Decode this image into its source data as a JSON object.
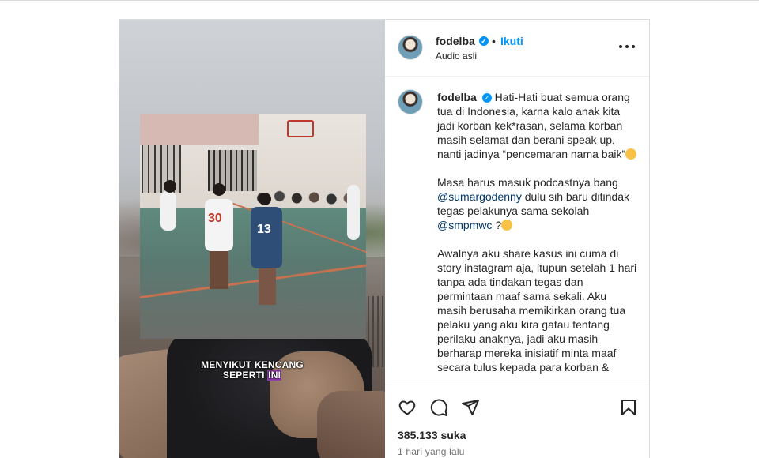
{
  "post": {
    "username": "fodelba",
    "follow_label": "Ikuti",
    "header_dot": "•",
    "audio_label": "Audio asli",
    "caption_overlay": {
      "line1": "MENYIKUT KENCANG",
      "line2_pre": "SEPERTI ",
      "line2_highlight": "INI"
    },
    "jersey_numbers": [
      "30",
      "13"
    ],
    "comment": {
      "username": "fodelba",
      "para1": "Hati-Hati buat semua orang tua di Indonesia, karna kalo anak kita jadi korban kek*rasan, selama korban masih selamat dan berani speak up, nanti jadinya “pencemaran nama baik”",
      "para2_a": "Masa harus masuk podcastnya bang",
      "mention1": "@sumargodenny",
      "para2_b": "dulu sih baru ditindak tegas pelakunya sama sekolah",
      "mention2": "@smpmwc",
      "para2_c": "?",
      "para3": "Awalnya aku share kasus ini cuma di story instagram aja, itupun setelah 1 hari tanpa ada tindakan tegas dan permintaan maaf sama sekali. Aku masih berusaha memikirkan orang tua pelaku yang aku kira gatau tentang perilaku anaknya, jadi aku masih berharap mereka inisiatif minta maaf secara tulus kepada para korban &"
    },
    "likes": "385.133 suka",
    "timestamp": "1 hari yang lalu"
  },
  "icons": {
    "verified": "verified-badge-icon",
    "more": "more-options-icon",
    "like": "heart-icon",
    "comment": "comment-bubble-icon",
    "share": "paper-plane-icon",
    "save": "bookmark-icon"
  },
  "colors": {
    "accent": "#0095f6",
    "text": "#262626",
    "muted": "#737373",
    "mention": "#00376b",
    "caption_highlight": "#8e3fa8"
  }
}
